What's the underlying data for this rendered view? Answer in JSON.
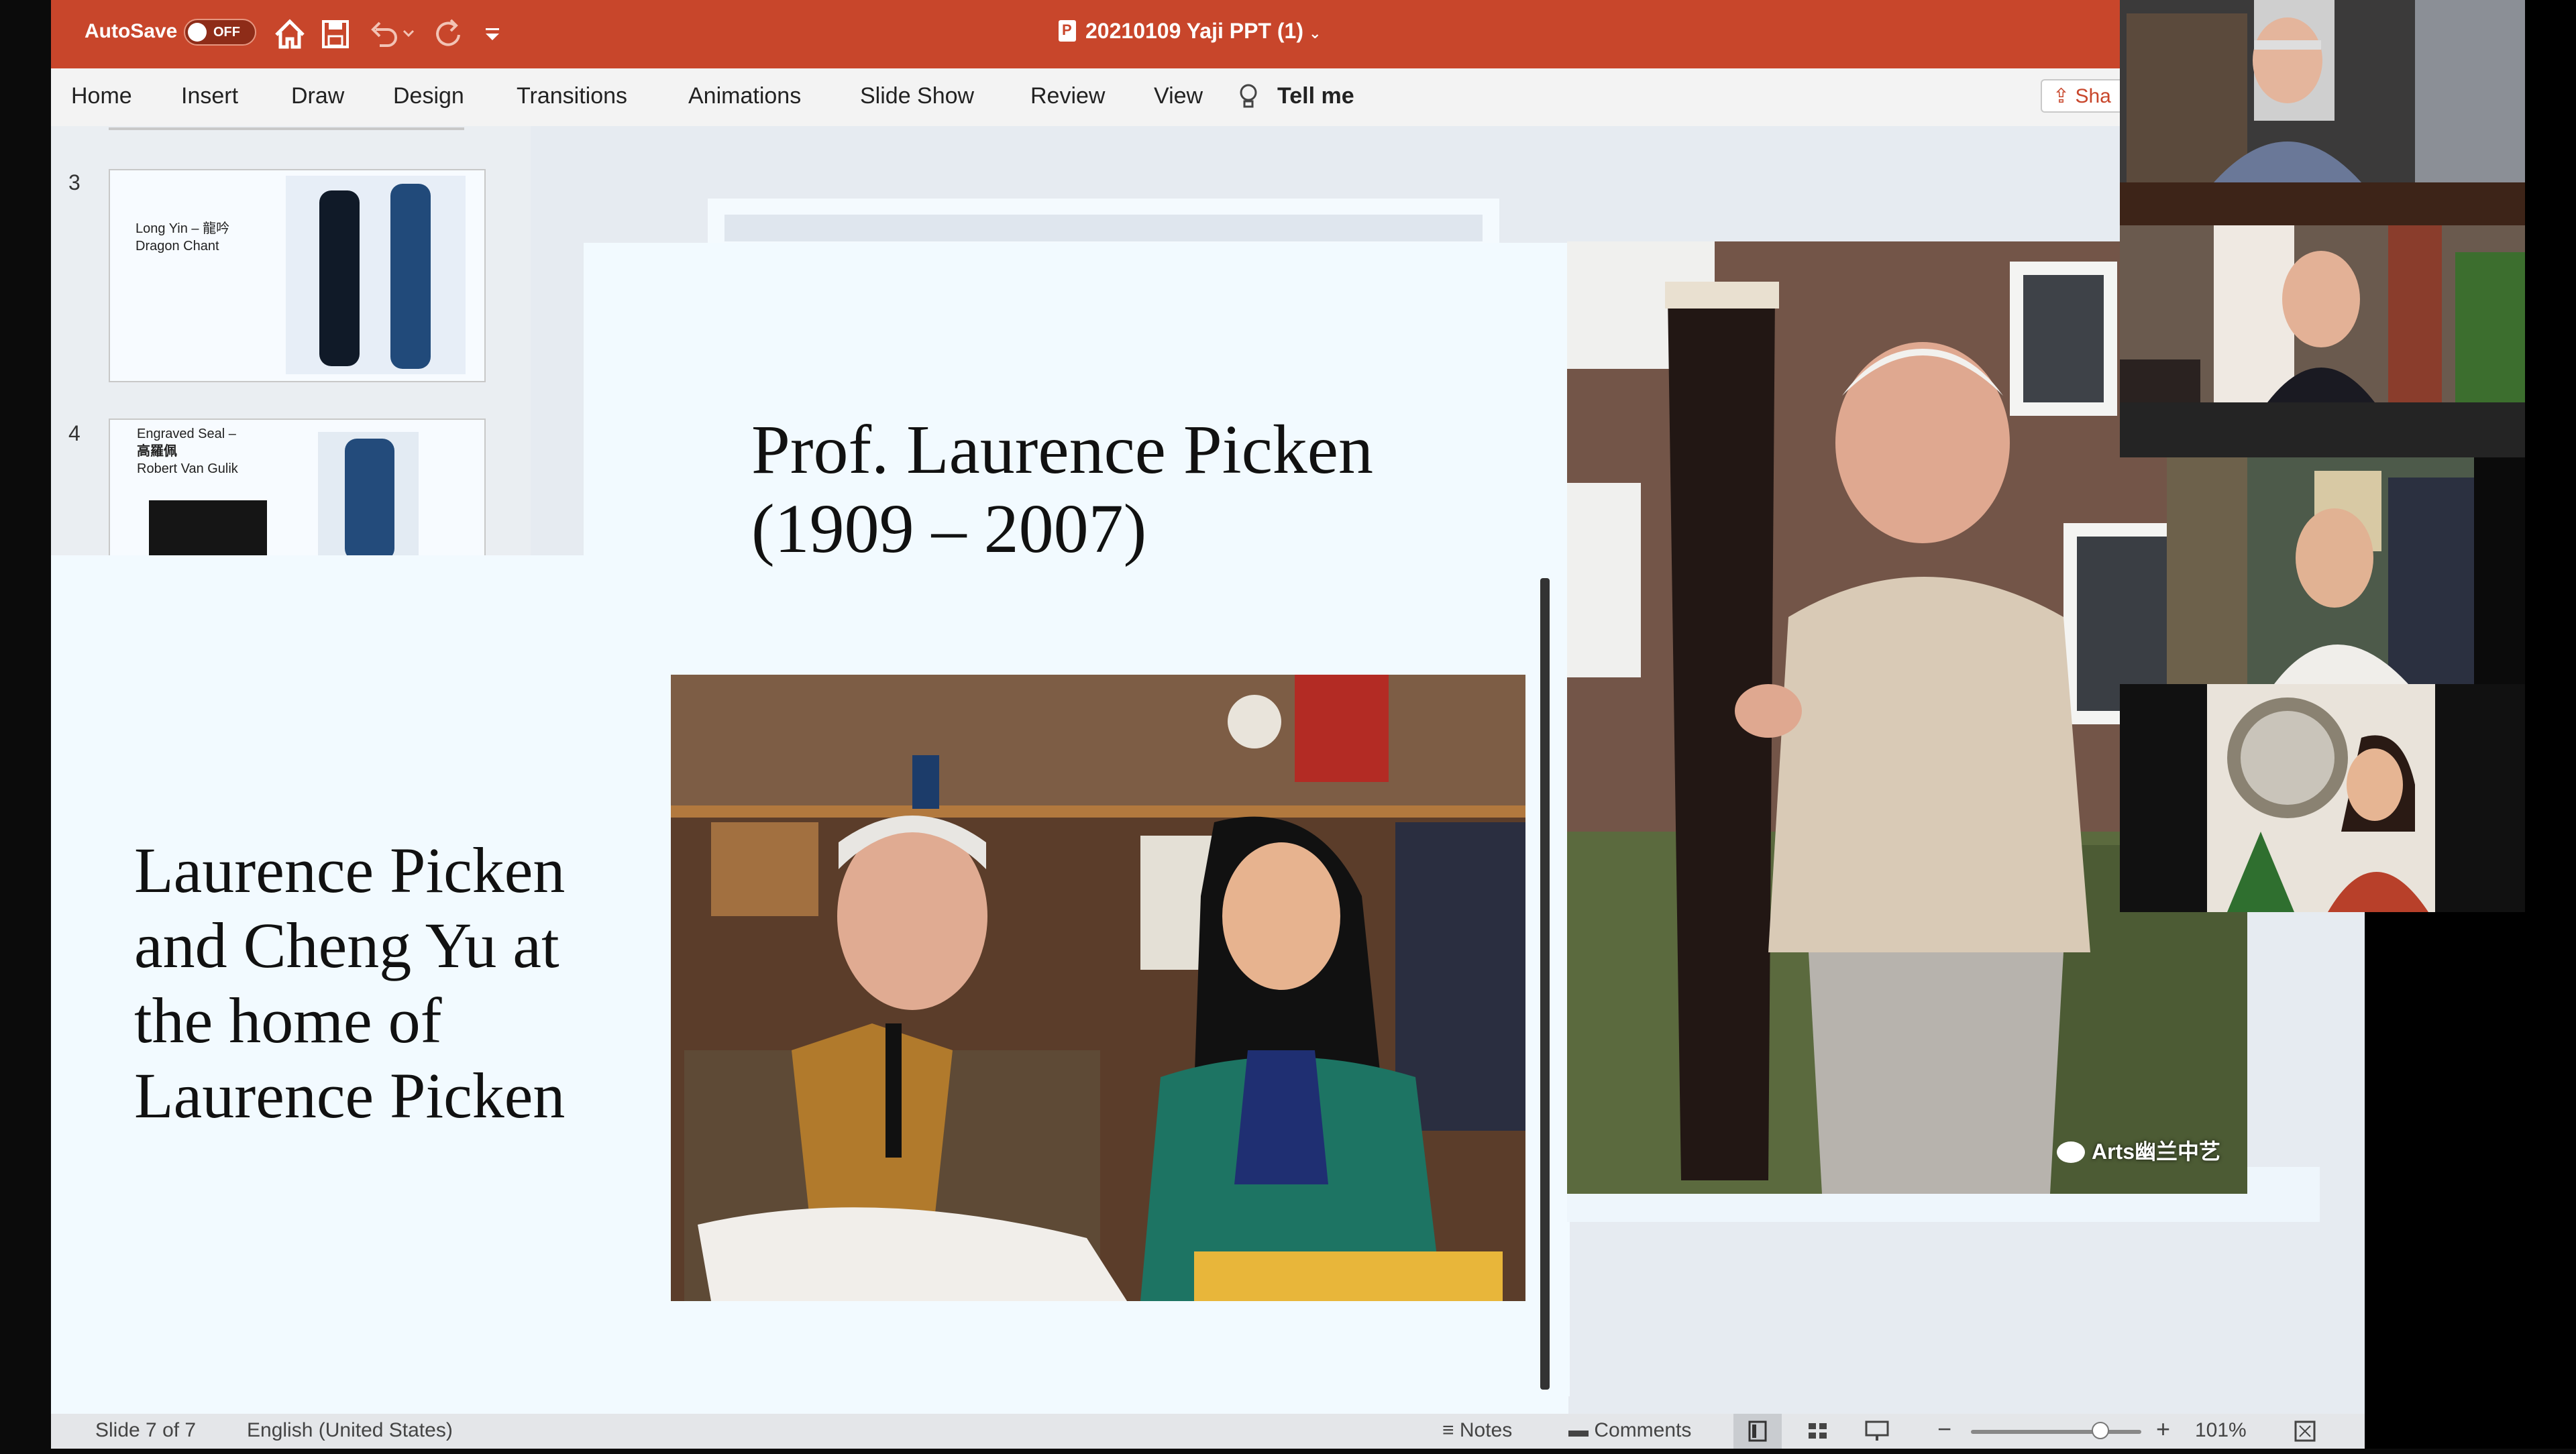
{
  "titlebar": {
    "autosave_label": "AutoSave",
    "autosave_state": "OFF",
    "document_title": "20210109 Yaji PPT (1)",
    "accent_color": "#c8462b"
  },
  "quick_access": {
    "icons": [
      "home-icon",
      "save-icon",
      "undo-icon",
      "redo-icon",
      "customize-icon"
    ]
  },
  "ribbon": {
    "tabs": [
      "Home",
      "Insert",
      "Draw",
      "Design",
      "Transitions",
      "Animations",
      "Slide Show",
      "Review",
      "View"
    ],
    "tell_me": "Tell me",
    "share_label": "Sha"
  },
  "thumbnails": [
    {
      "number": "3",
      "text_line1": "Long Yin – 龍吟",
      "text_line2": "Dragon Chant"
    },
    {
      "number": "4",
      "text_line1": "Engraved Seal –",
      "text_line2": "高羅佩",
      "text_line3": "Robert Van Gulik"
    }
  ],
  "slide": {
    "title_line1": "Prof. Laurence Picken",
    "title_line2": "(1909 – 2007)",
    "caption_lines": [
      "Laurence Picken",
      "and Cheng Yu at",
      "the home of",
      "Laurence Picken"
    ],
    "watermark": "Arts幽兰中艺"
  },
  "statusbar": {
    "slide_indicator": "Slide 7 of 7",
    "language": "English (United States)",
    "notes_label": "Notes",
    "comments_label": "Comments",
    "zoom_level": "101%",
    "zoom_fraction": 0.76
  }
}
